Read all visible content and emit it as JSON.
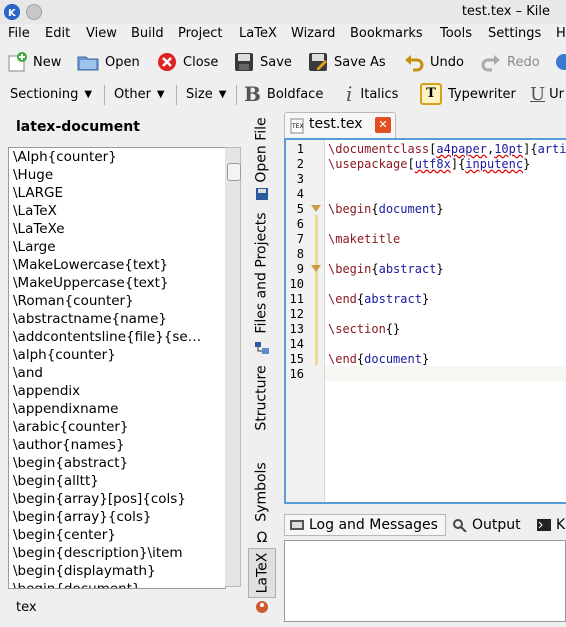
{
  "window": {
    "title": "test.tex – Kile"
  },
  "menu": [
    "File",
    "Edit",
    "View",
    "Build",
    "Project",
    "LaTeX",
    "Wizard",
    "Bookmarks",
    "Tools",
    "Settings",
    "H"
  ],
  "toolbar1": {
    "new": "New",
    "open": "Open",
    "close": "Close",
    "save": "Save",
    "save_as": "Save As",
    "undo": "Undo",
    "redo": "Redo"
  },
  "toolbar2": {
    "sectioning": "Sectioning",
    "other": "Other",
    "size": "Size",
    "boldface": "Boldface",
    "italics": "Italics",
    "typewriter": "Typewriter",
    "underline": "Ur"
  },
  "left_panel": {
    "title": "latex-document",
    "items": [
      "\\Alph{counter}",
      "\\Huge",
      "\\LARGE",
      "\\LaTeX",
      "\\LaTeXe",
      "\\Large",
      "\\MakeLowercase{text}",
      "\\MakeUppercase{text}",
      "\\Roman{counter}",
      "\\abstractname{name}",
      "\\addcontentsline{file}{se…",
      "\\alph{counter}",
      "\\and",
      "\\appendix",
      "\\appendixname",
      "\\arabic{counter}",
      "\\author{names}",
      "\\begin{abstract}",
      "\\begin{alltt}",
      "\\begin{array}[pos]{cols}",
      "\\begin{array}{cols}",
      "\\begin{center}",
      "\\begin{description}\\item",
      "\\begin{displaymath}",
      "\\begin{document}"
    ],
    "bottom_tab": "tex"
  },
  "side_tabs": [
    "Open File",
    "Files and Projects",
    "Structure",
    "Symbols",
    "LaTeX"
  ],
  "editor": {
    "tab_label": "test.tex",
    "line_numbers": [
      "1",
      "2",
      "3",
      "4",
      "5",
      "6",
      "7",
      "8",
      "9",
      "10",
      "11",
      "12",
      "13",
      "14",
      "15",
      "16"
    ]
  },
  "log_tabs": {
    "log": "Log and Messages",
    "output": "Output",
    "k": "K"
  },
  "colors": {
    "focus_border": "#5a9bd8",
    "command": "#8a1a24",
    "argument": "#1a1aa0"
  }
}
